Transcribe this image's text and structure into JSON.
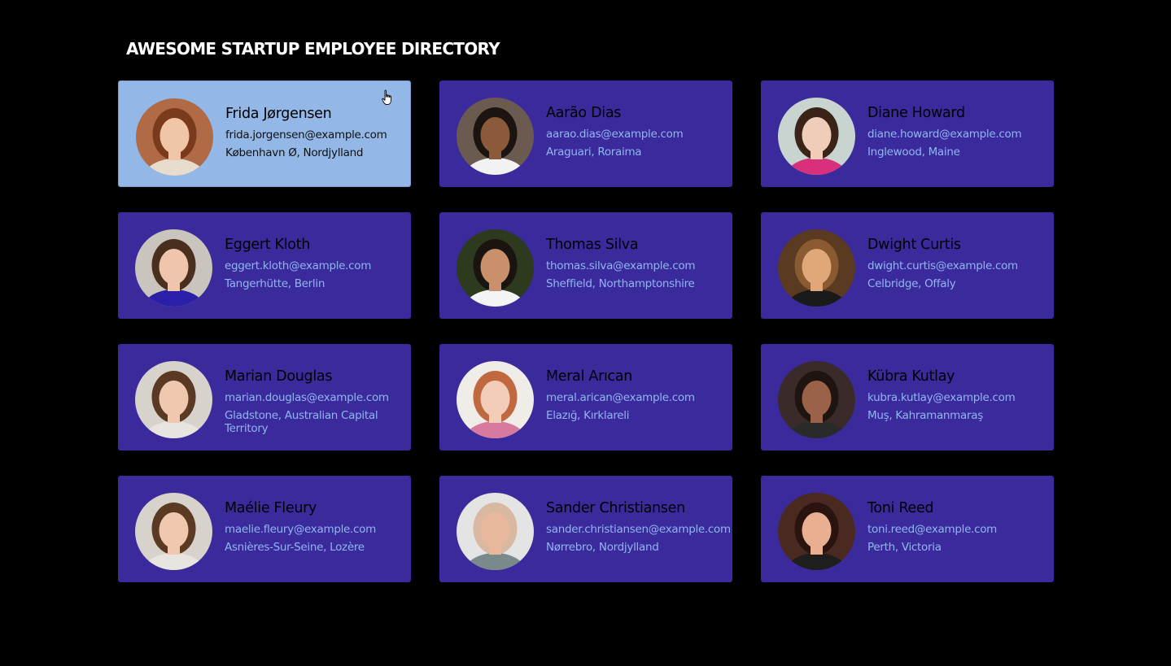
{
  "page": {
    "title": "AWESOME STARTUP EMPLOYEE DIRECTORY"
  },
  "colors": {
    "background": "#000000",
    "card": "#3b2a9c",
    "card_selected": "#93b7e6",
    "name_text": "#000000",
    "link_text": "#8fb6f0",
    "selected_text": "#111111"
  },
  "employees": [
    {
      "name": "Frida Jørgensen",
      "email": "frida.jorgensen@example.com",
      "location": "København Ø, Nordjylland",
      "selected": true,
      "avatar": {
        "bg": "#b06a45",
        "hair": "#7a3b1c",
        "skin": "#f1c6a8",
        "shirt": "#e8dccf"
      }
    },
    {
      "name": "Aarão Dias",
      "email": "aarao.dias@example.com",
      "location": "Araguari, Roraima",
      "selected": false,
      "avatar": {
        "bg": "#6b5a50",
        "hair": "#1c1410",
        "skin": "#8a5a3a",
        "shirt": "#f2f2f2"
      }
    },
    {
      "name": "Diane Howard",
      "email": "diane.howard@example.com",
      "location": "Inglewood, Maine",
      "selected": false,
      "avatar": {
        "bg": "#c8d4d0",
        "hair": "#3a2418",
        "skin": "#f0cdb8",
        "shirt": "#d8307a"
      }
    },
    {
      "name": "Eggert Kloth",
      "email": "eggert.kloth@example.com",
      "location": "Tangerhütte, Berlin",
      "selected": false,
      "avatar": {
        "bg": "#c9c4bd",
        "hair": "#4a2e1e",
        "skin": "#efc5ae",
        "shirt": "#2a1fa8"
      }
    },
    {
      "name": "Thomas Silva",
      "email": "thomas.silva@example.com",
      "location": "Sheffield, Northamptonshire",
      "selected": false,
      "avatar": {
        "bg": "#2e3a1e",
        "hair": "#1a1410",
        "skin": "#c8916c",
        "shirt": "#f4f4f4"
      }
    },
    {
      "name": "Dwight Curtis",
      "email": "dwight.curtis@example.com",
      "location": "Celbridge, Offaly",
      "selected": false,
      "avatar": {
        "bg": "#5a3a20",
        "hair": "#8a5a30",
        "skin": "#e0a878",
        "shirt": "#1a1a1a"
      }
    },
    {
      "name": "Marian Douglas",
      "email": "marian.douglas@example.com",
      "location": "Gladstone, Australian Capital Territory",
      "selected": false,
      "avatar": {
        "bg": "#d8d2cc",
        "hair": "#5a3a22",
        "skin": "#f0c8b0",
        "shirt": "#e8e4e0"
      }
    },
    {
      "name": "Meral Arıcan",
      "email": "meral.arican@example.com",
      "location": "Elazığ, Kırklareli",
      "selected": false,
      "avatar": {
        "bg": "#f0ece8",
        "hair": "#c06840",
        "skin": "#f4cdb8",
        "shirt": "#d87aa0"
      }
    },
    {
      "name": "Kübra Kutlay",
      "email": "kubra.kutlay@example.com",
      "location": "Muş, Kahramanmaraş",
      "selected": false,
      "avatar": {
        "bg": "#3a2a2a",
        "hair": "#1e1410",
        "skin": "#9a6248",
        "shirt": "#2a2a2a"
      }
    },
    {
      "name": "Maélie Fleury",
      "email": "maelie.fleury@example.com",
      "location": "Asnières-Sur-Seine, Lozère",
      "selected": false,
      "avatar": {
        "bg": "#d8d2cc",
        "hair": "#5a3a22",
        "skin": "#f0c8b0",
        "shirt": "#e8e4e0"
      }
    },
    {
      "name": "Sander Christiansen",
      "email": "sander.christiansen@example.com",
      "location": "Nørrebro, Nordjylland",
      "selected": false,
      "avatar": {
        "bg": "#e4e4e4",
        "hair": "#d8b8a0",
        "skin": "#e8b89c",
        "shirt": "#7a8a8a"
      }
    },
    {
      "name": "Toni Reed",
      "email": "toni.reed@example.com",
      "location": "Perth, Victoria",
      "selected": false,
      "avatar": {
        "bg": "#4a2a20",
        "hair": "#2a1410",
        "skin": "#e8b090",
        "shirt": "#1e1e1e"
      }
    }
  ]
}
